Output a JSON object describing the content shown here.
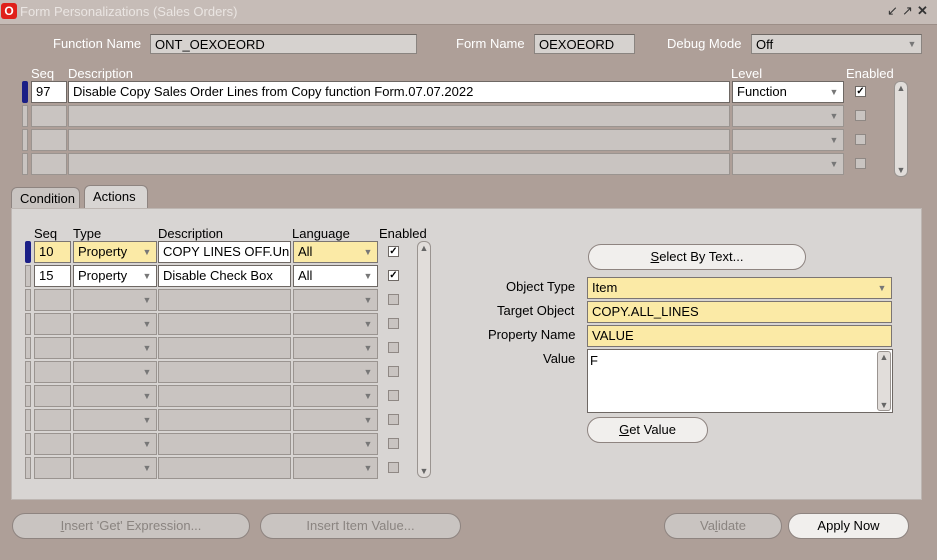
{
  "window": {
    "title": "Form Personalizations (Sales Orders)"
  },
  "header": {
    "function_name_label": "Function Name",
    "function_name_value": "ONT_OEXOEORD",
    "form_name_label": "Form Name",
    "form_name_value": "OEXOEORD",
    "debug_mode_label": "Debug Mode",
    "debug_mode_value": "Off"
  },
  "rules": {
    "headers": {
      "seq": "Seq",
      "description": "Description",
      "level": "Level",
      "enabled": "Enabled"
    },
    "rows": [
      {
        "seq": "97",
        "description": "Disable Copy Sales Order Lines from Copy function Form.07.07.2022",
        "level": "Function",
        "enabled": true
      }
    ]
  },
  "tabs": {
    "condition": "Condition",
    "actions": "Actions"
  },
  "actions": {
    "headers": {
      "seq": "Seq",
      "type": "Type",
      "description": "Description",
      "language": "Language",
      "enabled": "Enabled"
    },
    "rows": [
      {
        "seq": "10",
        "type": "Property",
        "description": "COPY LINES OFF.Un",
        "language": "All",
        "enabled": true
      },
      {
        "seq": "15",
        "type": "Property",
        "description": "Disable Check Box",
        "language": "All",
        "enabled": true
      }
    ]
  },
  "details": {
    "select_by_text_prefix": "S",
    "select_by_text_rest": "elect By Text...",
    "object_type_label": "Object Type",
    "object_type_value": "Item",
    "target_object_label": "Target Object",
    "target_object_value": "COPY.ALL_LINES",
    "property_name_label": "Property Name",
    "property_name_value": "VALUE",
    "value_label": "Value",
    "value_value": "F",
    "get_value_prefix": "G",
    "get_value_rest": "et Value"
  },
  "footer": {
    "insert_get_prefix": "I",
    "insert_get_rest": "nsert 'Get' Expression...",
    "insert_item_label": "Insert Item Value...",
    "validate_pre": "Va",
    "validate_u": "l",
    "validate_post": "idate",
    "apply_now_label": "Apply Now"
  }
}
